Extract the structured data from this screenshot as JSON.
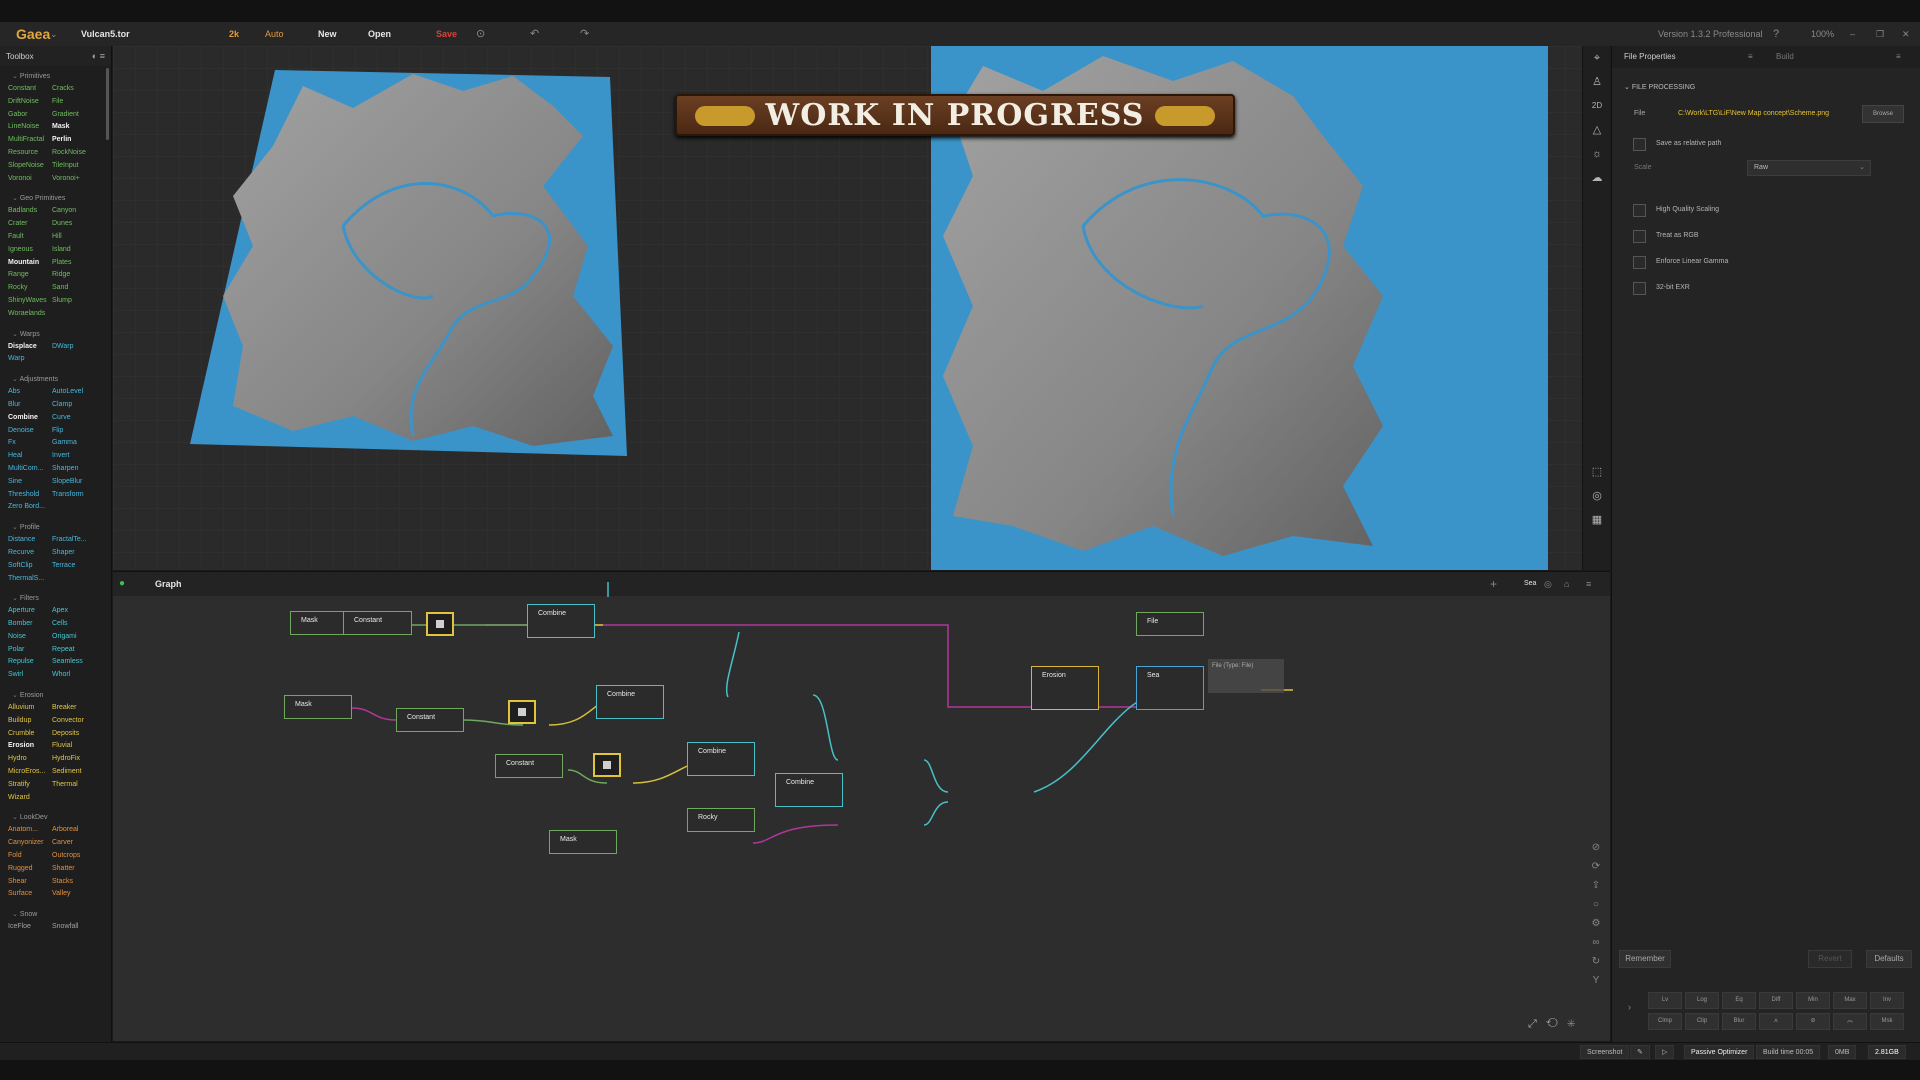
{
  "titlebar": {
    "app_name": "Gaea",
    "file_name": "Vulcan5.tor",
    "resolution": "2k",
    "mode": "Auto",
    "new_label": "New",
    "open_label": "Open",
    "save_label": "Save",
    "version": "Version 1.3.2 Professional",
    "zoom": "100%"
  },
  "toolbox": {
    "title": "Toolbox",
    "sections": [
      {
        "title": "Primitives",
        "items": [
          [
            "Constant",
            "c-green"
          ],
          [
            "Cracks",
            "c-green"
          ],
          [
            "DriftNoise",
            "c-green"
          ],
          [
            "File",
            "c-green"
          ],
          [
            "Gabor",
            "c-green"
          ],
          [
            "Gradient",
            "c-green"
          ],
          [
            "LineNoise",
            "c-green"
          ],
          [
            "Mask",
            "c-white"
          ],
          [
            "MultiFractal",
            "c-green"
          ],
          [
            "Perlin",
            "c-white"
          ],
          [
            "Resource",
            "c-green"
          ],
          [
            "RockNoise",
            "c-green"
          ],
          [
            "SlopeNoise",
            "c-green"
          ],
          [
            "TileInput",
            "c-green"
          ],
          [
            "Voronoi",
            "c-green"
          ],
          [
            "Voronoi+",
            "c-green"
          ]
        ]
      },
      {
        "title": "Geo Primitives",
        "items": [
          [
            "Badlands",
            "c-green"
          ],
          [
            "Canyon",
            "c-green"
          ],
          [
            "Crater",
            "c-green"
          ],
          [
            "Dunes",
            "c-green"
          ],
          [
            "Fault",
            "c-green"
          ],
          [
            "Hill",
            "c-green"
          ],
          [
            "Igneous",
            "c-green"
          ],
          [
            "Island",
            "c-green"
          ],
          [
            "Mountain",
            "c-white"
          ],
          [
            "Plates",
            "c-green"
          ],
          [
            "Range",
            "c-green"
          ],
          [
            "Ridge",
            "c-green"
          ],
          [
            "Rocky",
            "c-green"
          ],
          [
            "Sand",
            "c-green"
          ],
          [
            "ShinyWaves",
            "c-green"
          ],
          [
            "Slump",
            "c-green"
          ],
          [
            "Woraelands",
            "c-green"
          ]
        ]
      },
      {
        "title": "Warps",
        "items": [
          [
            "Displace",
            "c-white"
          ],
          [
            "DWarp",
            "c-blue"
          ],
          [
            "Warp",
            "c-blue"
          ]
        ]
      },
      {
        "title": "Adjustments",
        "items": [
          [
            "Abs",
            "c-blue"
          ],
          [
            "AutoLevel",
            "c-blue"
          ],
          [
            "Blur",
            "c-blue"
          ],
          [
            "Clamp",
            "c-blue"
          ],
          [
            "Combine",
            "c-white"
          ],
          [
            "Curve",
            "c-blue"
          ],
          [
            "Denoise",
            "c-blue"
          ],
          [
            "Flip",
            "c-blue"
          ],
          [
            "Fx",
            "c-blue"
          ],
          [
            "Gamma",
            "c-blue"
          ],
          [
            "Heal",
            "c-blue"
          ],
          [
            "Invert",
            "c-blue"
          ],
          [
            "MultiCom...",
            "c-blue"
          ],
          [
            "Sharpen",
            "c-blue"
          ],
          [
            "Sine",
            "c-blue"
          ],
          [
            "SlopeBlur",
            "c-blue"
          ],
          [
            "Threshold",
            "c-blue"
          ],
          [
            "Transform",
            "c-blue"
          ],
          [
            "Zero Bord...",
            "c-blue"
          ]
        ]
      },
      {
        "title": "Profile",
        "items": [
          [
            "Distance",
            "c-blue"
          ],
          [
            "FractalTe...",
            "c-blue"
          ],
          [
            "Recurve",
            "c-blue"
          ],
          [
            "Shaper",
            "c-blue"
          ],
          [
            "SoftClip",
            "c-blue"
          ],
          [
            "Terrace",
            "c-blue"
          ],
          [
            "ThermalS...",
            "c-blue"
          ]
        ]
      },
      {
        "title": "Filters",
        "items": [
          [
            "Aperture",
            "c-cyan"
          ],
          [
            "Apex",
            "c-cyan"
          ],
          [
            "Bomber",
            "c-cyan"
          ],
          [
            "Cells",
            "c-cyan"
          ],
          [
            "Noise",
            "c-cyan"
          ],
          [
            "Origami",
            "c-cyan"
          ],
          [
            "Polar",
            "c-cyan"
          ],
          [
            "Repeat",
            "c-cyan"
          ],
          [
            "Repulse",
            "c-cyan"
          ],
          [
            "Seamless",
            "c-cyan"
          ],
          [
            "Swirl",
            "c-cyan"
          ],
          [
            "Whorl",
            "c-cyan"
          ]
        ]
      },
      {
        "title": "Erosion",
        "items": [
          [
            "Alluvium",
            "c-yellow"
          ],
          [
            "Breaker",
            "c-yellow"
          ],
          [
            "Buildup",
            "c-yellow"
          ],
          [
            "Convector",
            "c-yellow"
          ],
          [
            "Crumble",
            "c-yellow"
          ],
          [
            "Deposits",
            "c-yellow"
          ],
          [
            "Erosion",
            "c-white"
          ],
          [
            "Fluvial",
            "c-yellow"
          ],
          [
            "Hydro",
            "c-yellow"
          ],
          [
            "HydroFix",
            "c-yellow"
          ],
          [
            "MicroEros...",
            "c-yellow"
          ],
          [
            "Sediment",
            "c-yellow"
          ],
          [
            "Stratify",
            "c-yellow"
          ],
          [
            "Thermal",
            "c-yellow"
          ],
          [
            "Wizard",
            "c-yellow"
          ]
        ]
      },
      {
        "title": "LookDev",
        "items": [
          [
            "Anatom...",
            "c-orange"
          ],
          [
            "Arboreal",
            "c-orange"
          ],
          [
            "Canyonizer",
            "c-orange"
          ],
          [
            "Carver",
            "c-orange"
          ],
          [
            "Fold",
            "c-orange"
          ],
          [
            "Outcrops",
            "c-orange"
          ],
          [
            "Rugged",
            "c-orange"
          ],
          [
            "Shatter",
            "c-orange"
          ],
          [
            "Shear",
            "c-orange"
          ],
          [
            "Stacks",
            "c-orange"
          ],
          [
            "Surface",
            "c-orange"
          ],
          [
            "Valley",
            "c-orange"
          ]
        ]
      },
      {
        "title": "Snow",
        "items": [
          [
            "IceFloe",
            "c-gray"
          ],
          [
            "Snowfall",
            "c-gray"
          ]
        ]
      }
    ]
  },
  "viewport": {
    "banner": "WORK IN PROGRESS",
    "view_mode": "2D"
  },
  "graph": {
    "title": "Graph",
    "toolbar_label": "Sea",
    "nodes": [
      {
        "id": "mask1",
        "label": "Mask",
        "color": "green"
      },
      {
        "id": "const1",
        "label": "Constant",
        "color": "green"
      },
      {
        "id": "combine1",
        "label": "Combine",
        "color": "cyan"
      },
      {
        "id": "mask2",
        "label": "Mask",
        "color": "green"
      },
      {
        "id": "const2",
        "label": "Constant",
        "color": "green"
      },
      {
        "id": "combine2",
        "label": "Combine",
        "color": "cyan"
      },
      {
        "id": "const3",
        "label": "Constant",
        "color": "green"
      },
      {
        "id": "combine3",
        "label": "Combine",
        "color": "cyan"
      },
      {
        "id": "combine4",
        "label": "Combine",
        "color": "cyan"
      },
      {
        "id": "rocky",
        "label": "Rocky",
        "color": "green"
      },
      {
        "id": "mask3",
        "label": "Mask",
        "color": "green"
      },
      {
        "id": "erosion",
        "label": "Erosion",
        "color": "yellow"
      },
      {
        "id": "sea",
        "label": "Sea",
        "color": "blue"
      },
      {
        "id": "file",
        "label": "File",
        "color": "green"
      }
    ],
    "tooltip": "File (Type: File)"
  },
  "properties": {
    "tab_file": "File Properties",
    "tab_build": "Build",
    "section": "FILE PROCESSING",
    "file_label": "File",
    "file_path": "C:\\Work\\LTG\\LiF\\New Map concept\\Scheme.png",
    "browse_label": "Browse",
    "relative_label": "Save as relative path",
    "scale_label": "Scale",
    "scale_value": "Raw",
    "options": [
      "High Quality Scaling",
      "Treat as RGB",
      "Enforce Linear Gamma",
      "32-bit EXR"
    ],
    "remember_label": "Remember",
    "revert_label": "Revert",
    "defaults_label": "Defaults",
    "mini_row1": [
      "Lv",
      "Log",
      "Eq",
      "Diff",
      "Min",
      "Max",
      "Inv"
    ],
    "mini_row2": [
      "Clmp",
      "Clip",
      "Blur",
      "⋏",
      "⊘",
      "︽",
      "Msk"
    ]
  },
  "status": {
    "screenshot_label": "Screenshot",
    "optimizer_label": "Passive Optimizer",
    "build_time": "Build time 00:05",
    "memory": "0MB",
    "memory_total": "2.81GB"
  },
  "colors": {
    "accent": "#e0a640",
    "water": "#3a94c9",
    "wire_magenta": "#b0379a",
    "wire_cyan": "#48c0c8",
    "wire_yellow": "#d7c13a",
    "wire_green": "#6fa85f"
  }
}
